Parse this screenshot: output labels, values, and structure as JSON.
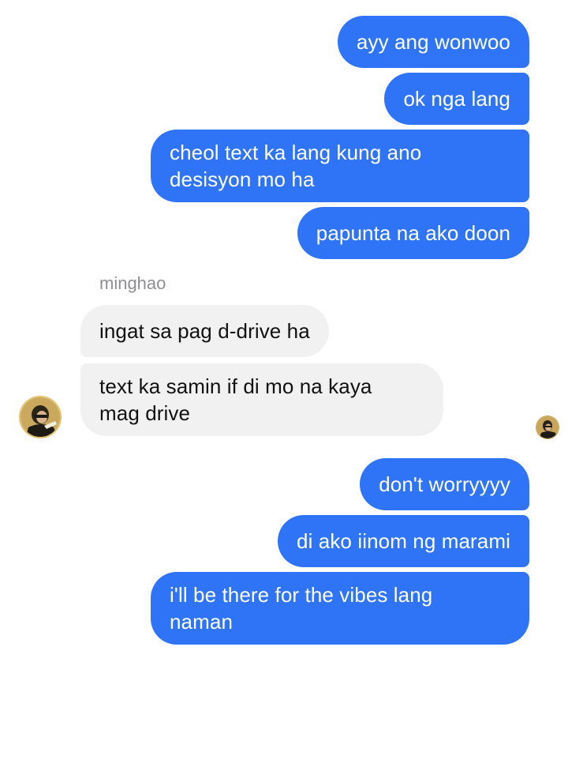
{
  "thread": {
    "sender_name": "minghao",
    "messages": [
      {
        "direction": "outgoing",
        "text": "ayy ang wonwoo"
      },
      {
        "direction": "outgoing",
        "text": "ok nga lang"
      },
      {
        "direction": "outgoing",
        "text": "cheol text ka lang kung ano\ndesisyon mo ha"
      },
      {
        "direction": "outgoing",
        "text": "papunta na ako doon"
      },
      {
        "direction": "incoming",
        "text": "ingat sa pag d-drive ha"
      },
      {
        "direction": "incoming",
        "text": "text ka samin if di mo na kaya\nmag drive"
      },
      {
        "direction": "outgoing",
        "text": "don't worryyyy"
      },
      {
        "direction": "outgoing",
        "text": "di ako iinom ng marami"
      },
      {
        "direction": "outgoing",
        "text": "i'll be there for the vibes lang\nnaman"
      }
    ],
    "colors": {
      "outgoing_bubble": "#2f74f6",
      "incoming_bubble": "#f1f1f1",
      "sender_name": "#8e8e93"
    },
    "avatars": [
      {
        "role": "sender-avatar",
        "icon": "profile-photo"
      },
      {
        "role": "read-receipt-avatar",
        "icon": "profile-photo"
      }
    ]
  }
}
